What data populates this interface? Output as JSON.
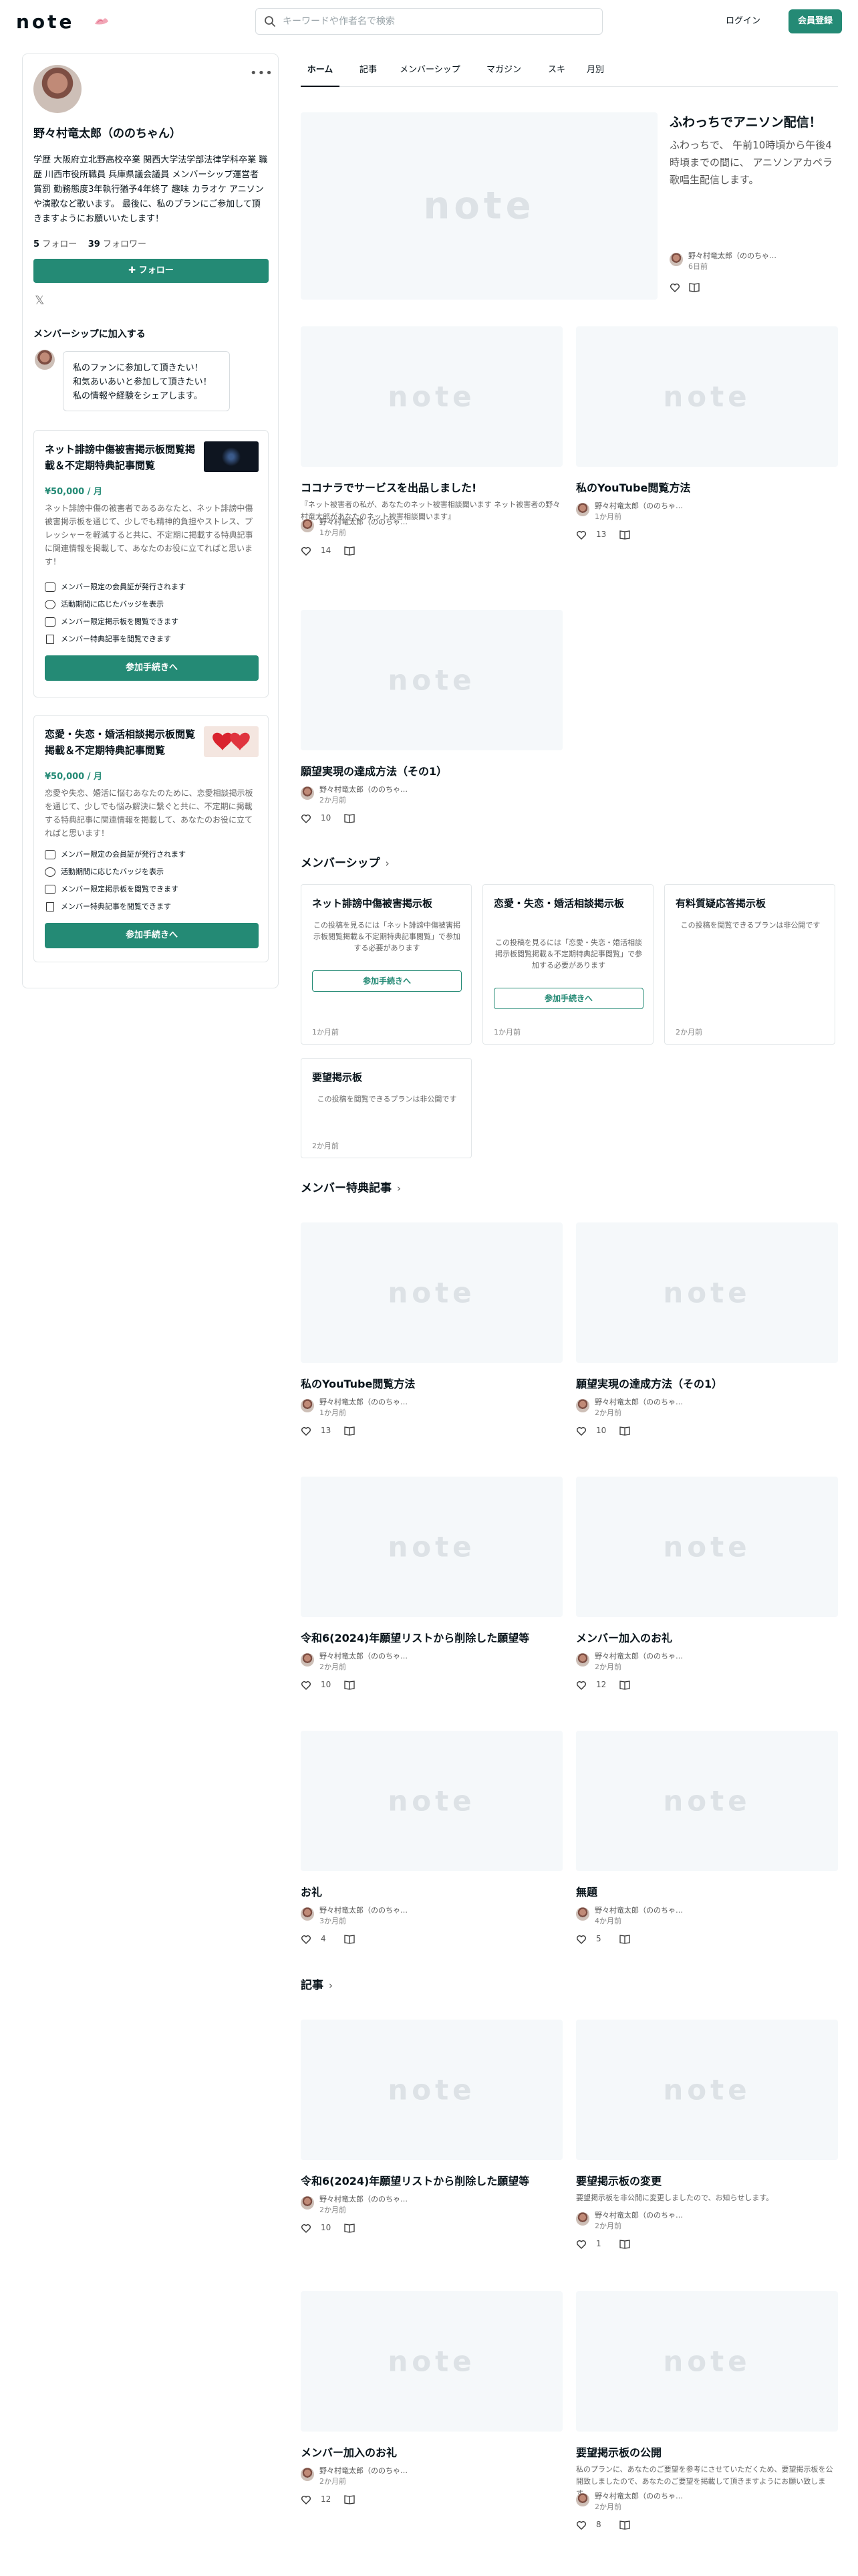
{
  "header": {
    "logo": "note",
    "search_placeholder": "キーワードや作者名で検索",
    "login": "ログイン",
    "signup": "会員登録"
  },
  "profile": {
    "name": "野々村竜太郎（ののちゃん）",
    "bio": "学歴 大阪府立北野高校卒業 関西大学法学部法律学科卒業 職歴 川西市役所職員 兵庫県議会議員 メンバーシップ運営者 賞罰 勤務態度3年執行猶予4年終了 趣味 カラオケ アニソンや演歌など歌います。 最後に、私のプランにご参加して頂きますようにお願いいたします！",
    "follow_count": "5",
    "follow_label": "フォロー",
    "follower_count": "39",
    "follower_label": "フォロワー",
    "follow_button": "フォロー",
    "join_section_label": "メンバーシップに加入する",
    "bubble_lines": [
      "私のファンに参加して頂きたい！",
      "和気あいあいと参加して頂きたい！",
      "私の情報や経験をシェアします。"
    ]
  },
  "plans": [
    {
      "title": "ネット誹謗中傷被害掲示板閲覧掲載＆不定期特典記事閲覧",
      "price": "¥50,000 / 月",
      "desc": "ネット誹謗中傷の被害者であるあなたと、ネット誹謗中傷被害掲示板を通じて、少しでも精神的負担やストレス、プレッシャーを軽減すると共に、不定期に掲載する特典記事に関連情報を掲載して、あなたのお役に立てればと思います！",
      "perks": [
        "メンバー限定の会員証が発行されます",
        "活動期間に応じたバッジを表示",
        "メンバー限定掲示板を閲覧できます",
        "メンバー特典記事を閲覧できます"
      ],
      "join": "参加手続きへ"
    },
    {
      "title": "恋愛・失恋・婚活相談掲示板閲覧掲載＆不定期特典記事閲覧",
      "price": "¥50,000 / 月",
      "desc": "恋愛や失恋、婚活に悩むあなたのために、恋愛相談掲示板を通じて、少しでも悩み解決に繋ぐと共に、不定期に掲載する特典記事に関連情報を掲載して、あなたのお役に立てればと思います！",
      "perks": [
        "メンバー限定の会員証が発行されます",
        "活動期間に応じたバッジを表示",
        "メンバー限定掲示板を閲覧できます",
        "メンバー特典記事を閲覧できます"
      ],
      "join": "参加手続きへ"
    }
  ],
  "tabs": [
    "ホーム",
    "記事",
    "メンバーシップ",
    "マガジン",
    "スキ",
    "月別"
  ],
  "featured": {
    "title": "ふわっちでアニソン配信！",
    "desc": "ふわっちで、 午前10時頃から午後4時頃までの間に、 アニソンアカペラ歌唱生配信します。",
    "author": "野々村竜太郎（ののちゃ…",
    "time": "6日前"
  },
  "thumb_logo": "note",
  "home_articles": [
    {
      "title": "ココナラでサービスを出品しました!",
      "excerpt": "『ネット被害者の私が、あなたのネット被害相談聞います ネット被害者の野々村竜太郎があなたのネット被害相談聞います』",
      "author": "野々村竜太郎（ののちゃ…",
      "time": "1か月前",
      "likes": "14"
    },
    {
      "title": "私のYouTube閲覧方法",
      "excerpt": "",
      "author": "野々村竜太郎（ののちゃ…",
      "time": "1か月前",
      "likes": "13"
    },
    {
      "title": "願望実現の達成方法（その1）",
      "excerpt": "",
      "author": "野々村竜太郎（ののちゃ…",
      "time": "2か月前",
      "likes": "10"
    }
  ],
  "membership_section": {
    "heading": "メンバーシップ",
    "boards": [
      {
        "title": "ネット誹謗中傷被害掲示板",
        "desc": "この投稿を見るには「ネット誹謗中傷被害掲示板閲覧掲載＆不定期特典記事閲覧」で参加する必要があります",
        "join": "参加手続きへ",
        "time": "1か月前"
      },
      {
        "title": "恋愛・失恋・婚活相談掲示板",
        "desc": "この投稿を見るには「恋愛・失恋・婚活相談掲示板閲覧掲載＆不定期特典記事閲覧」で参加する必要があります",
        "join": "参加手続きへ",
        "time": "1か月前"
      },
      {
        "title": "有料質疑応答掲示板",
        "desc": "この投稿を閲覧できるプランは非公開です",
        "join": "",
        "time": "2か月前"
      },
      {
        "title": "要望掲示板",
        "desc": "この投稿を閲覧できるプランは非公開です",
        "join": "",
        "time": "2か月前"
      }
    ]
  },
  "perk_section": {
    "heading": "メンバー特典記事",
    "articles": [
      {
        "title": "私のYouTube閲覧方法",
        "excerpt": "",
        "author": "野々村竜太郎（ののちゃ…",
        "time": "1か月前",
        "likes": "13"
      },
      {
        "title": "願望実現の達成方法（その1）",
        "excerpt": "",
        "author": "野々村竜太郎（ののちゃ…",
        "time": "2か月前",
        "likes": "10"
      },
      {
        "title": "令和6(2024)年願望リストから削除した願望等",
        "excerpt": "",
        "author": "野々村竜太郎（ののちゃ…",
        "time": "2か月前",
        "likes": "10"
      },
      {
        "title": "メンバー加入のお礼",
        "excerpt": "",
        "author": "野々村竜太郎（ののちゃ…",
        "time": "2か月前",
        "likes": "12"
      },
      {
        "title": "お礼",
        "excerpt": "",
        "author": "野々村竜太郎（ののちゃ…",
        "time": "3か月前",
        "likes": "4"
      },
      {
        "title": "無題",
        "excerpt": "",
        "author": "野々村竜太郎（ののちゃ…",
        "time": "4か月前",
        "likes": "5"
      }
    ]
  },
  "articles_section": {
    "heading": "記事",
    "articles": [
      {
        "title": "令和6(2024)年願望リストから削除した願望等",
        "excerpt": "",
        "author": "野々村竜太郎（ののちゃ…",
        "time": "2か月前",
        "likes": "10"
      },
      {
        "title": "要望掲示板の変更",
        "excerpt": "要望掲示板を非公開に変更しましたので、お知らせします。",
        "author": "野々村竜太郎（ののちゃ…",
        "time": "2か月前",
        "likes": "1"
      },
      {
        "title": "メンバー加入のお礼",
        "excerpt": "",
        "author": "野々村竜太郎（ののちゃ…",
        "time": "2か月前",
        "likes": "12"
      },
      {
        "title": "要望掲示板の公開",
        "excerpt": "私のプランに、あなたのご要望を参考にさせていただくため、要望掲示板を公開致しましたので、あなたのご要望を掲載して頂きますようにお願い致します。",
        "author": "野々村竜太郎（ののちゃ…",
        "time": "2か月前",
        "likes": "8"
      }
    ]
  },
  "colors": {
    "accent": "#248a75",
    "placeholder_bg": "#f5f8fa",
    "border": "#e2e6e8"
  }
}
